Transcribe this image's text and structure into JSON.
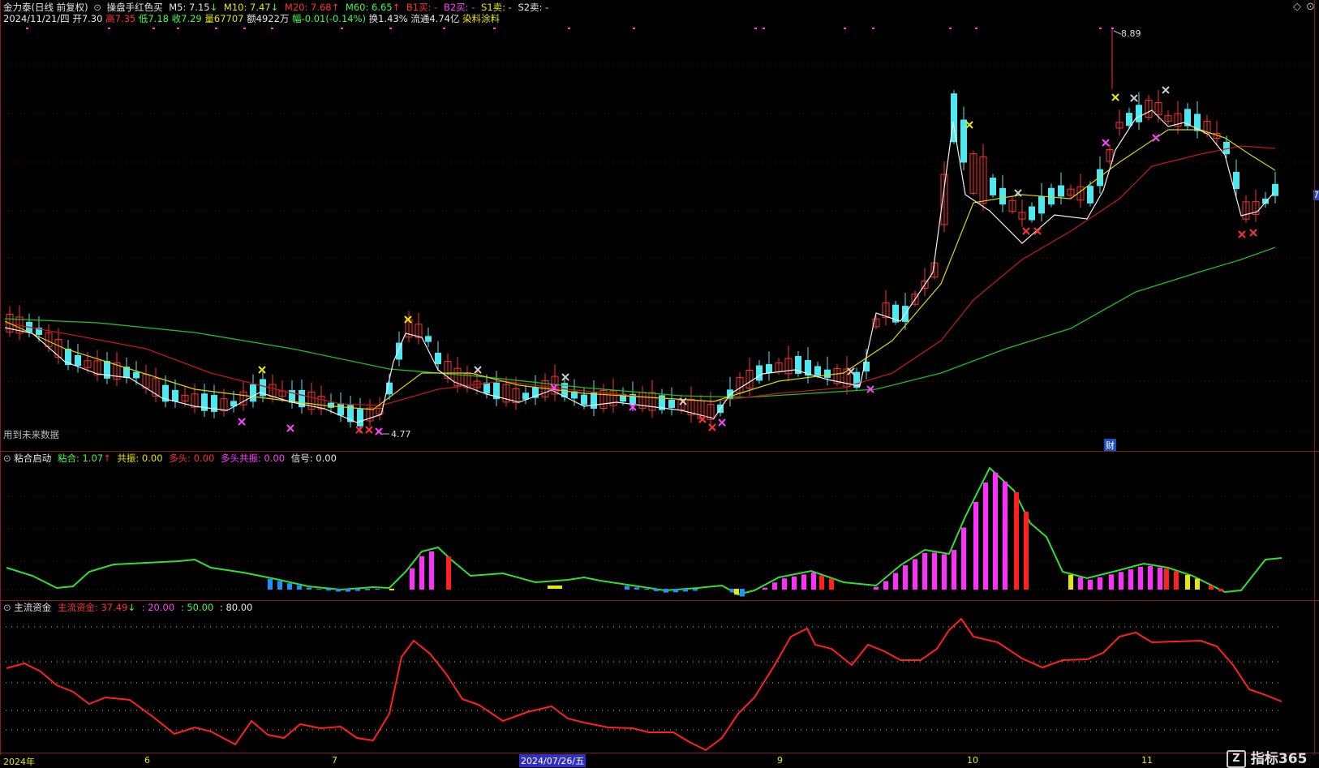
{
  "header": {
    "stock": "金力泰(日线 前复权)",
    "indicator": "操盘手红色买",
    "ma": [
      {
        "label": "M5: 7.15",
        "arrow": "↓",
        "color": "#e8e8e8"
      },
      {
        "label": "M10: 7.47",
        "arrow": "↓",
        "color": "#e8e800"
      },
      {
        "label": "M20: 7.68",
        "arrow": "↑",
        "color": "#ff3030"
      },
      {
        "label": "M60: 6.65",
        "arrow": "↑",
        "color": "#40ff40"
      }
    ],
    "signals": [
      {
        "label": "B1买: -",
        "color": "#ff3030"
      },
      {
        "label": "B2买: -",
        "color": "#ff40ff"
      },
      {
        "label": "S1卖: -",
        "color": "#e8e800"
      },
      {
        "label": "S2卖: -",
        "color": "#e8e8e8"
      }
    ],
    "info_date": "2024/11/21/四",
    "info_open": "开7.30",
    "info_high": "高7.35",
    "info_low": "低7.18",
    "info_close": "收7.29",
    "info_vol": "量67707",
    "info_amount": "额4922万",
    "info_change": "幅-0.01(-0.14%)",
    "info_turnover": "换1.43%",
    "info_float": "流通4.74亿",
    "info_tag": "染料涂料"
  },
  "main_panel": {
    "high_label": "8.89",
    "low_label": "4.77",
    "future_note": "用到未来数据",
    "finance_badge": "财",
    "right_price_tag": "7"
  },
  "panel2": {
    "title": "粘合启动",
    "items": [
      {
        "label": "粘合: 1.07",
        "arrow": "↑",
        "color": "#40ff40"
      },
      {
        "label": "共振: 0.00",
        "color": "#e8e800"
      },
      {
        "label": "多头: 0.00",
        "color": "#ff3030"
      },
      {
        "label": "多头共振: 0.00",
        "color": "#ff40ff"
      },
      {
        "label": "信号: 0.00",
        "color": "#e8e8e8"
      }
    ]
  },
  "panel3": {
    "title": "主流资金",
    "items": [
      {
        "label": "主流资金: 37.49",
        "arrow": "↓",
        "color": "#ff3030"
      },
      {
        "label": ": 20.00",
        "color": "#ff40ff"
      },
      {
        "label": ": 50.00",
        "color": "#40ff40"
      },
      {
        "label": ": 80.00",
        "color": "#e8e8e8"
      }
    ]
  },
  "xaxis": {
    "labels": [
      {
        "text": "2024年"
      },
      {
        "text": "6"
      },
      {
        "text": "7"
      },
      {
        "text": "2024/07/26/五"
      },
      {
        "text": "9"
      },
      {
        "text": "10"
      },
      {
        "text": "11"
      }
    ]
  },
  "logo": "指标365",
  "colors": {
    "up": "#ff3030",
    "down": "#50e8f0",
    "bg": "#000000",
    "frame": "#8b1a1a"
  }
}
